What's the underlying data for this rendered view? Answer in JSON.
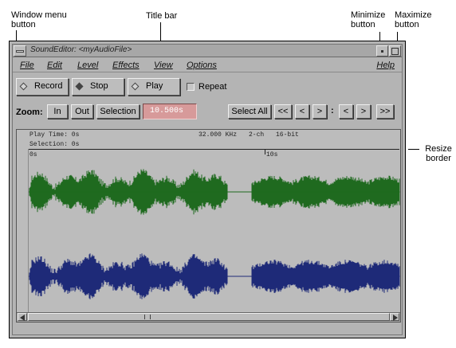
{
  "annotations": {
    "window_menu_button": "Window menu\nbutton",
    "title_bar": "Title bar",
    "minimize_button": "Minimize\nbutton",
    "maximize_button": "Maximize\nbutton",
    "resize_border": "Resize\nborder"
  },
  "window": {
    "title": "SoundEditor: <myAudioFile>"
  },
  "menubar": {
    "items": [
      "File",
      "Edit",
      "Level",
      "Effects",
      "View",
      "Options"
    ],
    "help": "Help"
  },
  "transport": {
    "record": "Record",
    "stop": "Stop",
    "play": "Play",
    "repeat": "Repeat",
    "repeat_checked": false
  },
  "zoom": {
    "label": "Zoom:",
    "in": "In",
    "out": "Out",
    "selection": "Selection",
    "time": "10.500s",
    "select_all": "Select All",
    "nav1": "<<",
    "nav2": "<",
    "nav3": ">",
    "sep": ":",
    "nav4": "<",
    "nav5": ">",
    "nav6": ">>"
  },
  "info": {
    "play_time": "Play Time: 0s",
    "selection": "Selection: 0s",
    "rate": "32.000 KHz",
    "channels": "2-ch",
    "bits": "16-bit"
  },
  "ruler": {
    "start": "0s",
    "mark": "10s"
  },
  "colors": {
    "left_channel": "#1f6a1f",
    "right_channel": "#1e2a78",
    "time_field": "#d79a9a"
  }
}
